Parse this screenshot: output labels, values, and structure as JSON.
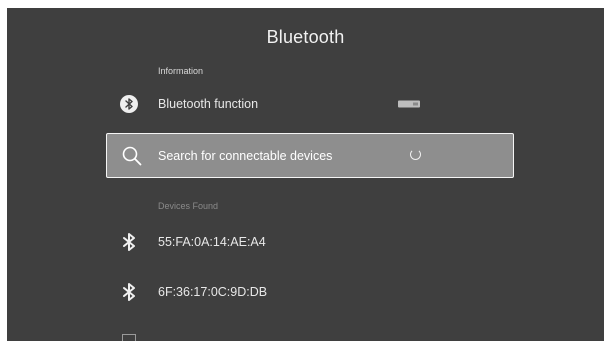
{
  "header": {
    "title": "Bluetooth"
  },
  "sections": {
    "information_label": "Information",
    "devices_found_label": "Devices Found"
  },
  "bluetooth_function": {
    "label": "Bluetooth function",
    "icon": "bluetooth-icon",
    "toggle_state": "on"
  },
  "search": {
    "label": "Search for connectable devices",
    "icon": "search-icon",
    "status": "loading-spinner"
  },
  "devices": [
    {
      "address": "55:FA:0A:14:AE:A4",
      "icon": "bluetooth-icon"
    },
    {
      "address": "6F:36:17:0C:9D:DB",
      "icon": "bluetooth-icon"
    }
  ],
  "colors": {
    "background": "#3f3f3f",
    "selected_background": "#8e8e8e",
    "selected_border": "#f5f5f5",
    "text": "#e8e8e8"
  }
}
